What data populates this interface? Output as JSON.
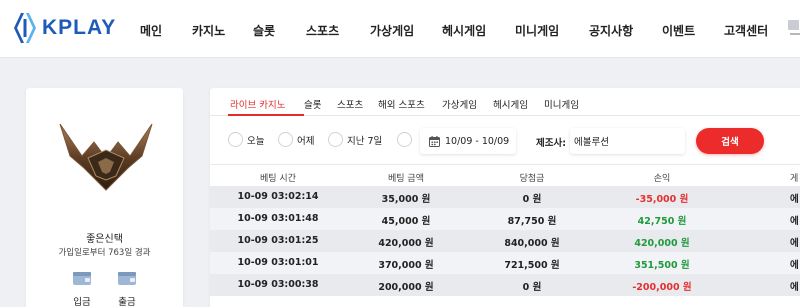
{
  "brand": {
    "name": "KPLAY"
  },
  "nav": {
    "items": [
      "메인",
      "카지노",
      "슬롯",
      "스포츠",
      "가상게임",
      "헤시게임",
      "미니게임",
      "공지사항",
      "이벤트",
      "고객센터"
    ]
  },
  "profile": {
    "username": "좋은신택",
    "since": "가입일로부터 763일 경과",
    "deposit_label": "입금",
    "withdraw_label": "출금"
  },
  "tabs": {
    "items": [
      "라이브 카지노",
      "슬롯",
      "스포츠",
      "해외 스포츠",
      "가상게임",
      "헤시게임",
      "미니게임"
    ],
    "active": "라이브 카지노"
  },
  "filters": {
    "radios": [
      "오늘",
      "어제",
      "지난 7일",
      ""
    ],
    "date_range": "10/09 - 10/09",
    "manufacturer_label": "제조사:",
    "manufacturer_value": "에볼루션",
    "search_label": "검색"
  },
  "table": {
    "headers": [
      "베팅 시간",
      "베팅 금액",
      "당첨금",
      "손익",
      "게"
    ],
    "rows": [
      {
        "time": "10-09 03:02:14",
        "bet": "35,000 원",
        "win": "0 원",
        "pl": "-35,000 원",
        "pl_type": "loss",
        "game": "에"
      },
      {
        "time": "10-09 03:01:48",
        "bet": "45,000 원",
        "win": "87,750 원",
        "pl": "42,750 원",
        "pl_type": "gain",
        "game": "에"
      },
      {
        "time": "10-09 03:01:25",
        "bet": "420,000 원",
        "win": "840,000 원",
        "pl": "420,000 원",
        "pl_type": "gain",
        "game": "에"
      },
      {
        "time": "10-09 03:01:01",
        "bet": "370,000 원",
        "win": "721,500 원",
        "pl": "351,500 원",
        "pl_type": "gain",
        "game": "에"
      },
      {
        "time": "10-09 03:00:38",
        "bet": "200,000 원",
        "win": "0 원",
        "pl": "-200,000 원",
        "pl_type": "loss",
        "game": "에"
      }
    ]
  },
  "colors": {
    "accent": "#e52d2d",
    "brand": "#1e5bb8",
    "loss": "#e53030",
    "gain": "#1f9a3c"
  }
}
